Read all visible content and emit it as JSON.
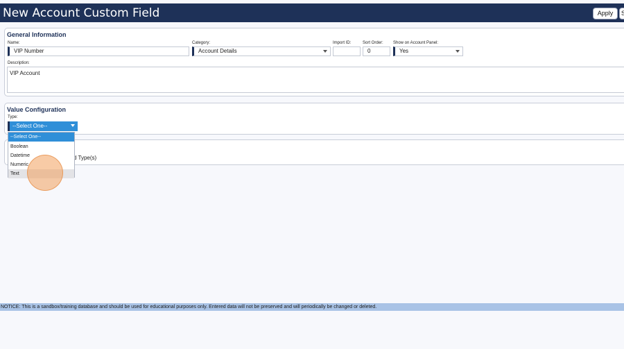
{
  "header": {
    "title": "New Account Custom Field",
    "apply_label": "Apply",
    "save_label": "S"
  },
  "general": {
    "section_title": "General Information",
    "name": {
      "label": "Name:",
      "value": "VIP Number"
    },
    "category": {
      "label": "Category:",
      "value": "Account Details"
    },
    "import_id": {
      "label": "Import ID:",
      "value": ""
    },
    "sort_order": {
      "label": "Sort Order:",
      "value": "0"
    },
    "show_on_panel": {
      "label": "Show on Account Panel:",
      "value": "Yes"
    },
    "description": {
      "label": "Description:",
      "value": "VIP Account"
    }
  },
  "value_config": {
    "section_title": "Value Configuration",
    "type_label": "Type:",
    "type_value": "--Select One--",
    "options": [
      "--Select One--",
      "Boolean",
      "Datetime",
      "Numeric",
      "Text"
    ],
    "selected_index": 0,
    "hover_index": 4
  },
  "obscured_text": "d Type(s)",
  "notice": "NOTICE: This is a sandbox/training database and should be used for educational purposes only. Entered data will not be preserved and will periodically be changed or deleted.",
  "colors": {
    "header_bg": "#1e3158",
    "select_blue": "#2f8fd8",
    "notice_bg": "#a9c3e6",
    "cursor": "#f3a05c"
  }
}
